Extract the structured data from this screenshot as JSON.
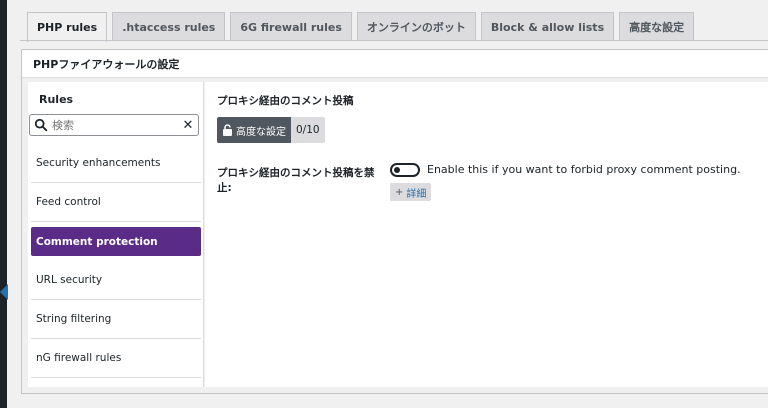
{
  "tabs": [
    {
      "label": "PHP rules",
      "active": true
    },
    {
      "label": ".htaccess rules",
      "active": false
    },
    {
      "label": "6G firewall rules",
      "active": false
    },
    {
      "label": "オンラインのボット",
      "active": false
    },
    {
      "label": "Block & allow lists",
      "active": false
    },
    {
      "label": "高度な設定",
      "active": false
    }
  ],
  "panel": {
    "title": "PHPファイアウォールの設定"
  },
  "sidebar": {
    "title": "Rules",
    "search": {
      "placeholder": "検索",
      "value": ""
    },
    "items": [
      {
        "label": "Security enhancements",
        "active": false
      },
      {
        "label": "Feed control",
        "active": false
      },
      {
        "label": "Comment protection",
        "active": true
      },
      {
        "label": "URL security",
        "active": false
      },
      {
        "label": "String filtering",
        "active": false
      },
      {
        "label": "nG firewall rules",
        "active": false
      }
    ]
  },
  "content": {
    "section_title": "プロキシ経由のコメント投稿",
    "level_button": "高度な設定",
    "level_count": "0/10",
    "setting_label": "プロキシ経由のコメント投稿を禁止:",
    "setting_desc": "Enable this if you want to forbid proxy comment posting.",
    "toggle_on": false,
    "details_plus": "+",
    "details_label": "詳細"
  },
  "colors": {
    "accent": "#5b2c87",
    "link": "#2271b1",
    "dark": "#1d2327"
  }
}
